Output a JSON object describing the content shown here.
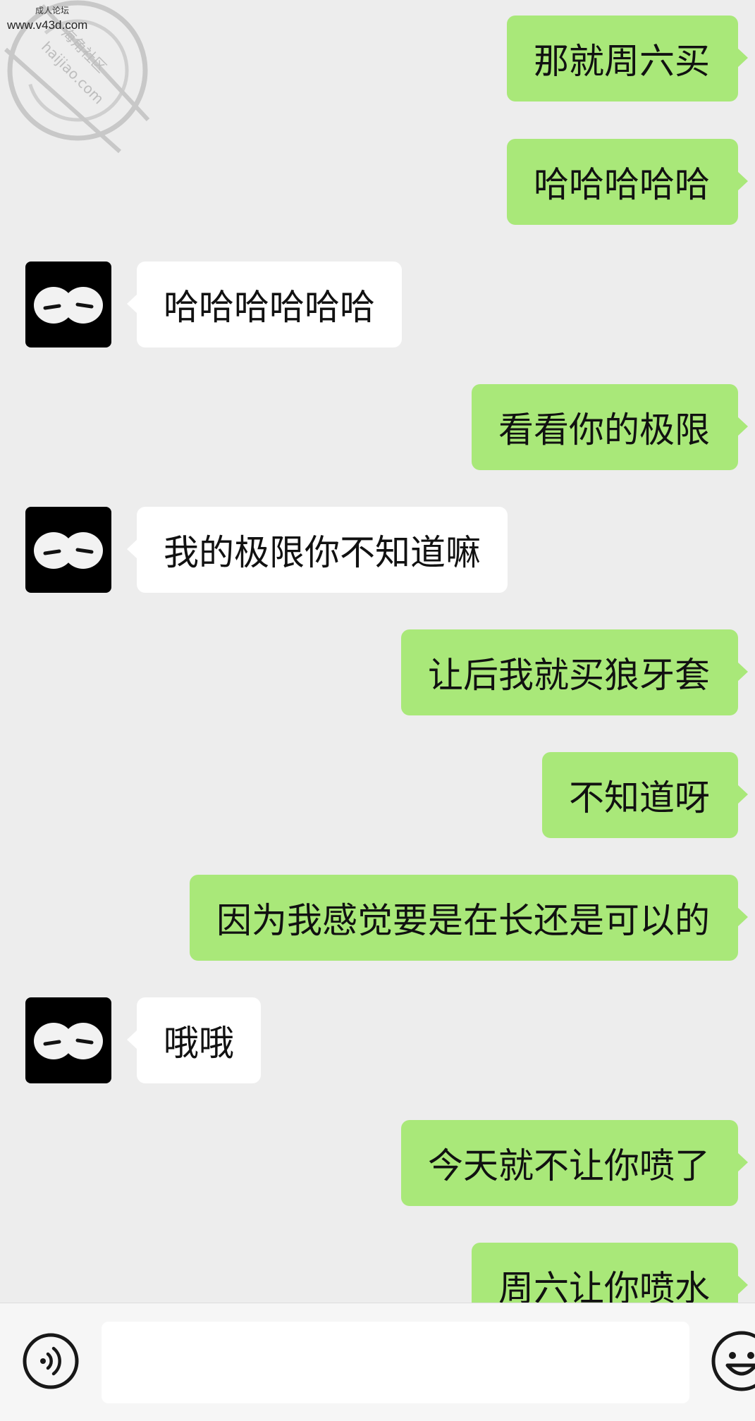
{
  "watermark": {
    "top_text": "成人论坛",
    "url": "www.v43d.com",
    "seal_text": "海角社区",
    "seal_domain": "haijiao.com"
  },
  "messages": [
    {
      "side": "out",
      "text": "那就周六买"
    },
    {
      "side": "out",
      "text": "哈哈哈哈哈"
    },
    {
      "side": "in",
      "text": "哈哈哈哈哈哈"
    },
    {
      "side": "out",
      "text": "看看你的极限"
    },
    {
      "side": "in",
      "text": "我的极限你不知道嘛"
    },
    {
      "side": "out",
      "text": "让后我就买狼牙套"
    },
    {
      "side": "out",
      "text": "不知道呀"
    },
    {
      "side": "out",
      "text": "因为我感觉要是在长还是可以的"
    },
    {
      "side": "in",
      "text": "哦哦"
    },
    {
      "side": "out",
      "text": "今天就不让你喷了"
    },
    {
      "side": "out",
      "text": "周六让你喷水"
    }
  ],
  "input": {
    "value": "",
    "placeholder": ""
  },
  "icons": {
    "voice": "voice-icon",
    "emoji": "emoji-icon",
    "avatar": "sleepy-eyes-avatar"
  },
  "colors": {
    "background": "#ededed",
    "outgoing_bubble": "#a9e879",
    "incoming_bubble": "#ffffff",
    "avatar_bg": "#000000"
  }
}
